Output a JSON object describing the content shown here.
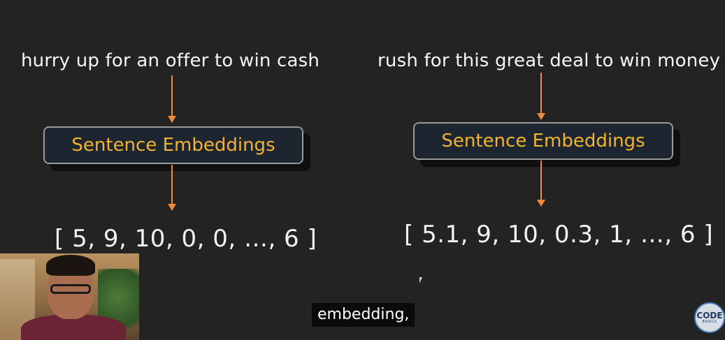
{
  "left": {
    "sentence": "hurry up for an offer to win cash",
    "embedding_label": "Sentence Embeddings",
    "vector": "[ 5, 9, 10, 0, 0, …, 6 ]"
  },
  "right": {
    "sentence": "rush for this great deal to win money",
    "embedding_label": "Sentence Embeddings",
    "vector": "[ 5.1, 9, 10, 0.3, 1, …, 6 ]"
  },
  "caption": "embedding,",
  "logo": {
    "main": "CODE",
    "sub": "BASICS"
  },
  "colors": {
    "background": "#232323",
    "arrow": "#f08a3c",
    "embedding_text": "#f3b32d",
    "box_fill": "#1d2530"
  }
}
